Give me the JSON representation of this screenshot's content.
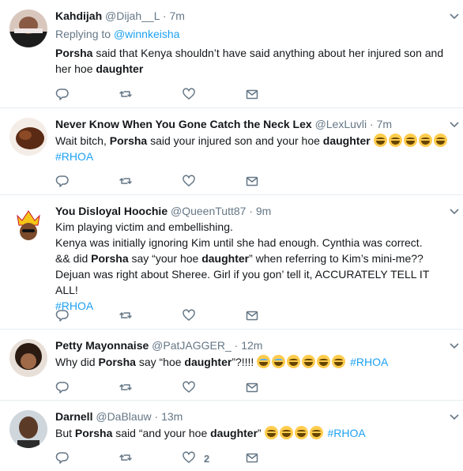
{
  "tweets": [
    {
      "name": "Kahdijah",
      "handle": "@Dijah__L",
      "time": "7m",
      "replying_prefix": "Replying to ",
      "replying_handle": "@winnkeisha",
      "segments": [
        {
          "t": "Porsha",
          "b": true
        },
        {
          "t": " said that Kenya shouldn’t have said anything about her injured son and her hoe "
        },
        {
          "t": "daughter",
          "b": true
        }
      ],
      "likes": ""
    },
    {
      "name": "Never Know When You Gone Catch the Neck Lex",
      "handle": "@LexLuvli",
      "time": "7m",
      "segments": [
        {
          "t": "Wait bitch, "
        },
        {
          "t": "Porsha",
          "b": true
        },
        {
          "t": " said your injured son and your hoe "
        },
        {
          "t": "daughter",
          "b": true
        },
        {
          "t": " "
        },
        {
          "emoji": "laugh"
        },
        {
          "emoji": "laugh"
        },
        {
          "emoji": "laugh"
        },
        {
          "emoji": "laugh"
        },
        {
          "emoji": "laugh"
        },
        {
          "br": true
        },
        {
          "t": "#RHOA",
          "tag": true
        }
      ],
      "likes": ""
    },
    {
      "name": "You Disloyal Hoochie",
      "handle": "@QueenTutt87",
      "time": "9m",
      "segments": [
        {
          "t": "Kim playing victim and embellishing."
        },
        {
          "br": true
        },
        {
          "t": "Kenya was initially ignoring Kim until she had enough. Cynthia was correct."
        },
        {
          "br": true
        },
        {
          "t": "&& did "
        },
        {
          "t": "Porsha",
          "b": true
        },
        {
          "t": " say “your hoe "
        },
        {
          "t": "daughter",
          "b": true
        },
        {
          "t": "” when referring to Kim’s mini-me??"
        },
        {
          "br": true
        },
        {
          "t": "Dejuan was right about Sheree. Girl if you gon’ tell it, ACCURATELY TELL IT ALL!"
        },
        {
          "br": true
        },
        {
          "t": "#RHOA",
          "tag": true
        }
      ],
      "likes": ""
    },
    {
      "name": "Petty Mayonnaise",
      "handle": "@PatJAGGER_",
      "time": "12m",
      "segments": [
        {
          "t": "Why did "
        },
        {
          "t": "Porsha",
          "b": true
        },
        {
          "t": " say “hoe "
        },
        {
          "t": "daughter",
          "b": true
        },
        {
          "t": "”?!!!! "
        },
        {
          "emoji": "cry"
        },
        {
          "emoji": "cry"
        },
        {
          "emoji": "laugh"
        },
        {
          "emoji": "laugh"
        },
        {
          "emoji": "laugh"
        },
        {
          "emoji": "laugh"
        },
        {
          "t": " "
        },
        {
          "t": "#RHOA",
          "tag": true
        }
      ],
      "likes": ""
    },
    {
      "name": "Darnell",
      "handle": "@DaBlauw",
      "time": "13m",
      "segments": [
        {
          "t": "But "
        },
        {
          "t": "Porsha",
          "b": true
        },
        {
          "t": " said “and your hoe "
        },
        {
          "t": "daughter",
          "b": true
        },
        {
          "t": "” "
        },
        {
          "emoji": "laugh"
        },
        {
          "emoji": "laugh"
        },
        {
          "emoji": "laugh"
        },
        {
          "emoji": "laugh"
        },
        {
          "t": " "
        },
        {
          "t": "#RHOA",
          "tag": true
        }
      ],
      "likes": "2"
    }
  ],
  "dot": "·",
  "colors": {
    "accent": "#1da1f2",
    "muted": "#657786",
    "divider": "#e6ecf0"
  },
  "icons": [
    "reply-icon",
    "retweet-icon",
    "like-icon",
    "dm-icon",
    "chevron-down-icon"
  ]
}
